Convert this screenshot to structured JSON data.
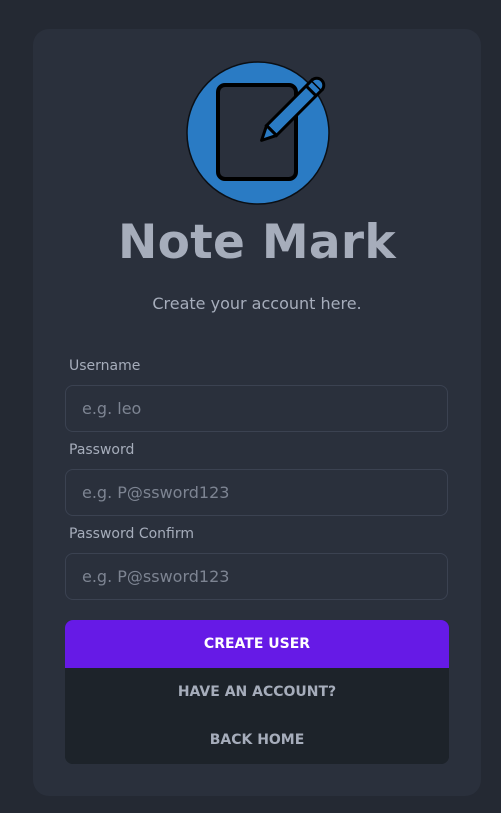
{
  "app": {
    "title": "Note Mark",
    "subtitle": "Create your account here."
  },
  "form": {
    "username": {
      "label": "Username",
      "placeholder": "e.g. leo",
      "value": ""
    },
    "password": {
      "label": "Password",
      "placeholder": "e.g. P@ssword123",
      "value": ""
    },
    "password_confirm": {
      "label": "Password Confirm",
      "placeholder": "e.g. P@ssword123",
      "value": ""
    }
  },
  "actions": {
    "create_user": "CREATE USER",
    "have_account": "HAVE AN ACCOUNT?",
    "back_home": "BACK HOME"
  },
  "icons": {
    "logo": "note-edit-icon"
  },
  "colors": {
    "background": "#242933",
    "card": "#2a303c",
    "text": "#a6adbb",
    "primary": "#661ae6",
    "logo_blue": "#2a7bc4",
    "secondary_buttons": "#1d232a"
  }
}
